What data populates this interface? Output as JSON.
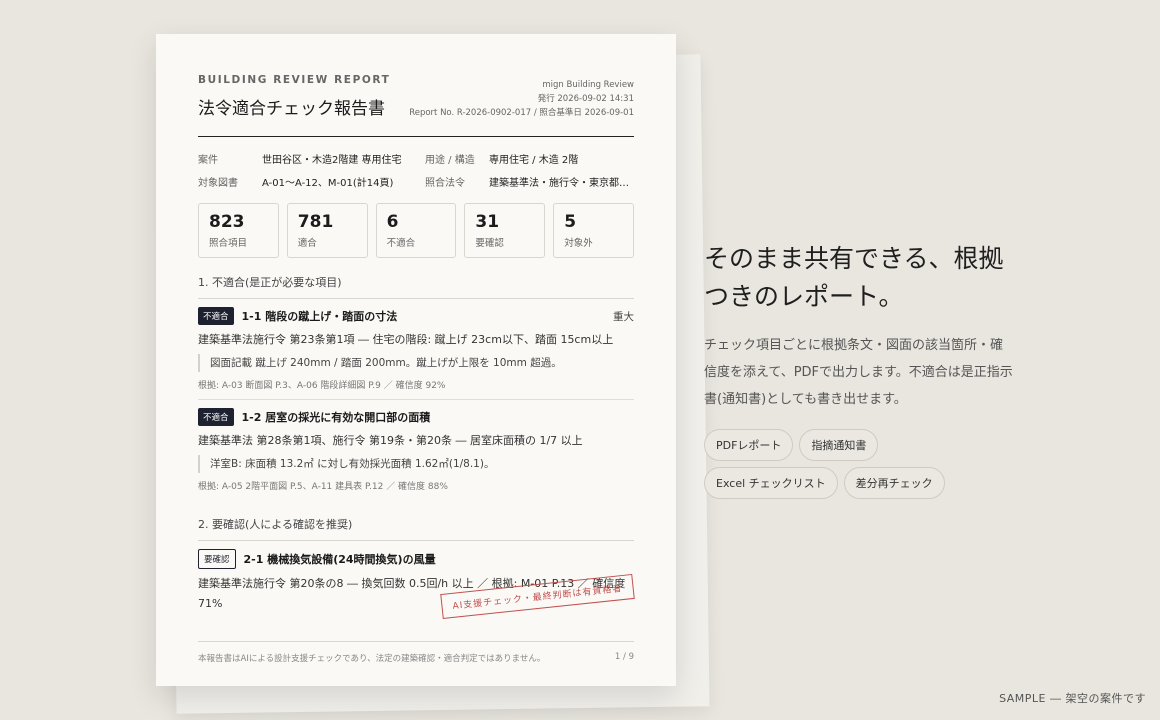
{
  "report": {
    "eyebrow": "BUILDING REVIEW REPORT",
    "title": "法令適合チェック報告書",
    "meta": {
      "org": "mign Building Review",
      "issued": "発行 2026-09-02 14:31",
      "ref": "Report No. R-2026-0902-017 / 照合基準日 2026-09-01"
    },
    "info": [
      {
        "label": "案件",
        "value": "世田谷区・木造2階建 専用住宅"
      },
      {
        "label": "用途 / 構造",
        "value": "専用住宅 / 木造 2階"
      },
      {
        "label": "対象図書",
        "value": "A-01〜A-12、M-01(計14頁)"
      },
      {
        "label": "照合法令",
        "value": "建築基準法・施行令・東京都条例"
      }
    ],
    "stats": [
      {
        "num": "823",
        "label": "照合項目"
      },
      {
        "num": "781",
        "label": "適合"
      },
      {
        "num": "6",
        "label": "不適合"
      },
      {
        "num": "31",
        "label": "要確認"
      },
      {
        "num": "5",
        "label": "対象外"
      }
    ],
    "section1": "1. 不適合(是正が必要な項目)",
    "items1": [
      {
        "badge": "不適合",
        "title": "1-1 階段の蹴上げ・踏面の寸法",
        "severity": "重大",
        "clause": "建築基準法施行令 第23条第1項 ― 住宅の階段: 蹴上げ 23cm以下、踏面 15cm以上",
        "quote": "図面記載 蹴上げ 240mm / 踏面 200mm。蹴上げが上限を 10mm 超過。",
        "basis": "根拠: A-03 断面図 P.3、A-06 階段詳細図 P.9 ／ 確信度 92%"
      },
      {
        "badge": "不適合",
        "title": "1-2 居室の採光に有効な開口部の面積",
        "severity": "",
        "clause": "建築基準法 第28条第1項、施行令 第19条・第20条 ― 居室床面積の 1/7 以上",
        "quote": "洋室B: 床面積 13.2㎡ に対し有効採光面積 1.62㎡(1/8.1)。",
        "basis": "根拠: A-05 2階平面図 P.5、A-11 建具表 P.12 ／ 確信度 88%"
      }
    ],
    "section2": "2. 要確認(人による確認を推奨)",
    "items2": [
      {
        "badge": "要確認",
        "title": "2-1 機械換気設備(24時間換気)の風量",
        "clause": "建築基準法施行令 第20条の8 ― 換気回数 0.5回/h 以上 ／ 根拠: M-01 P.13 ／ 確信度 71%"
      }
    ],
    "stamp": "AI支援チェック・最終判断は有資格者",
    "footer": {
      "disclaimer": "本報告書はAIによる設計支援チェックであり、法定の建築確認・適合判定ではありません。",
      "page": "1 / 9"
    }
  },
  "side": {
    "headline": "そのまま共有できる、根拠つきのレポート。",
    "description": "チェック項目ごとに根拠条文・図面の該当箇所・確信度を添えて、PDFで出力します。不適合は是正指示書(通知書)としても書き出せます。",
    "chips": [
      "PDFレポート",
      "指摘通知書",
      "Excel チェックリスト",
      "差分再チェック"
    ]
  },
  "sample_note": "SAMPLE ― 架空の案件です"
}
